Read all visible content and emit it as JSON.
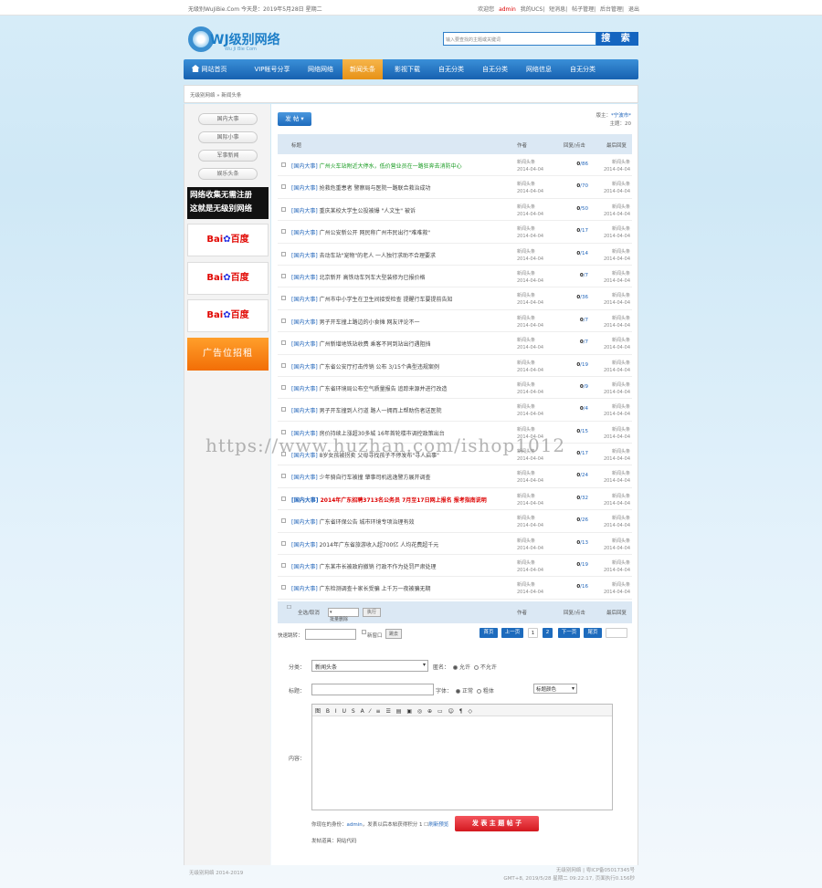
{
  "topbar": {
    "left": "无级别WuJiBie.Com 今天是：2019年5月28日 星期二",
    "welcome": "欢迎您",
    "user": "admin",
    "links": [
      "我的UCS",
      "短消息",
      "帖子管理",
      "后台管理",
      "退出"
    ]
  },
  "logo": {
    "title": "WJ级别网络",
    "subtitle": "Wu Ji Bie Com"
  },
  "search": {
    "placeholder": "输入要查找的主题或关键词",
    "button": "搜 索"
  },
  "nav": {
    "items": [
      "网站首页",
      "VIP帐号分享",
      "网络网络",
      "新闻头条",
      "影视下载",
      "自无分类",
      "自无分类",
      "网络信息",
      "自无分类"
    ]
  },
  "breadcrumb": "无级别网络 » 新闻头条",
  "sidebar": {
    "buttons": [
      "国内大事",
      "国际小事",
      "军事新闻",
      "娱乐头条"
    ],
    "promo_lines": [
      "网络收集无需注册",
      "这就是无级别网络"
    ],
    "baidu": {
      "part1": "Bai",
      "part2": "百度"
    },
    "ad": "广告位招租"
  },
  "board": {
    "post_label": "发 帖",
    "master_label": "版主：",
    "master": "*宁波市*",
    "topics_label": "主题：",
    "topics": "20"
  },
  "table": {
    "headers": {
      "title": "标题",
      "author": "作者",
      "replies": "回复/点击",
      "last": "最后回复"
    },
    "rows": [
      {
        "cat": "[国内大事]",
        "title": "广州火车站附近大停水，低价营业员在一路狂奔去消防中心",
        "style": "green",
        "author": "新闻头条",
        "date": "2014-04-04",
        "r": "0",
        "v": "86",
        "last_by": "新闻头条",
        "last_date": "2014-04-04"
      },
      {
        "cat": "[国内大事]",
        "title": "抢救危重患者 警察局与医院一路联合救治成功",
        "style": "",
        "author": "新闻头条",
        "date": "2014-04-04",
        "r": "0",
        "v": "70",
        "last_by": "新闻头条",
        "last_date": "2014-04-04"
      },
      {
        "cat": "[国内大事]",
        "title": "重庆某校大学生公投被爆 \"人文生\" 被诉",
        "style": "",
        "author": "新闻头条",
        "date": "2014-04-04",
        "r": "0",
        "v": "50",
        "last_by": "新闻头条",
        "last_date": "2014-04-04"
      },
      {
        "cat": "[国内大事]",
        "title": "广州公安新公开 网民称广州市民出行\"难难救\"",
        "style": "",
        "author": "新闻头条",
        "date": "2014-04-04",
        "r": "0",
        "v": "17",
        "last_by": "新闻头条",
        "last_date": "2014-04-04"
      },
      {
        "cat": "[国内大事]",
        "title": "去动车站\"宠物\"的老人 一人独行求助不合理要求",
        "style": "",
        "author": "新闻头条",
        "date": "2014-04-04",
        "r": "0",
        "v": "14",
        "last_by": "新闻头条",
        "last_date": "2014-04-04"
      },
      {
        "cat": "[国内大事]",
        "title": "北京新开 高铁动车列车大型装修为已报价格",
        "style": "",
        "author": "新闻头条",
        "date": "2014-04-04",
        "r": "0",
        "v": "7",
        "last_by": "新闻头条",
        "last_date": "2014-04-04"
      },
      {
        "cat": "[国内大事]",
        "title": "广州市中小学生在卫生间接受检查 提醒行车要提前告知",
        "style": "",
        "author": "新闻头条",
        "date": "2014-04-04",
        "r": "0",
        "v": "36",
        "last_by": "新闻头条",
        "last_date": "2014-04-04"
      },
      {
        "cat": "[国内大事]",
        "title": "男子开车撞上路边的小食摊 网友评论不一",
        "style": "",
        "author": "新闻头条",
        "date": "2014-04-04",
        "r": "0",
        "v": "7",
        "last_by": "新闻头条",
        "last_date": "2014-04-04"
      },
      {
        "cat": "[国内大事]",
        "title": "广州新增地铁站收费 乘客不同到站出行遇阻挡",
        "style": "",
        "author": "新闻头条",
        "date": "2014-04-04",
        "r": "0",
        "v": "7",
        "last_by": "新闻头条",
        "last_date": "2014-04-04"
      },
      {
        "cat": "[国内大事]",
        "title": "广东省公安厅打击传销 公布 3/15个典型违规案例",
        "style": "",
        "author": "新闻头条",
        "date": "2014-04-04",
        "r": "0",
        "v": "19",
        "last_by": "新闻头条",
        "last_date": "2014-04-04"
      },
      {
        "cat": "[国内大事]",
        "title": "广东省环境局公布空气质量报告 追踪来源并进行改造",
        "style": "",
        "author": "新闻头条",
        "date": "2014-04-04",
        "r": "0",
        "v": "9",
        "last_by": "新闻头条",
        "last_date": "2014-04-04"
      },
      {
        "cat": "[国内大事]",
        "title": "男子开车撞到人行道 路人一拥而上帮助伤者送医院",
        "style": "",
        "author": "新闻头条",
        "date": "2014-04-04",
        "r": "0",
        "v": "4",
        "last_by": "新闻头条",
        "last_date": "2014-04-04"
      },
      {
        "cat": "[国内大事]",
        "title": "房价持续上涨超30多城 16年首轮楼市调控政策出台",
        "style": "",
        "author": "新闻头条",
        "date": "2014-04-04",
        "r": "0",
        "v": "15",
        "last_by": "新闻头条",
        "last_date": "2014-04-04"
      },
      {
        "cat": "[国内大事]",
        "title": "8岁女孩被拐卖 父母寻找孩子不停发布\"寻人启事\"",
        "style": "",
        "author": "新闻头条",
        "date": "2014-04-04",
        "r": "0",
        "v": "17",
        "last_by": "新闻头条",
        "last_date": "2014-04-04"
      },
      {
        "cat": "[国内大事]",
        "title": "少年骑自行车被撞 肇事司机逃逸警方展开调查",
        "style": "",
        "author": "新闻头条",
        "date": "2014-04-04",
        "r": "0",
        "v": "24",
        "last_by": "新闻头条",
        "last_date": "2014-04-04"
      },
      {
        "cat": "[国内大事]",
        "title": "2014年广东招聘3713名公务员 7月至17日网上报名 报考指南说明",
        "style": "red",
        "author": "新闻头条",
        "date": "2014-04-04",
        "r": "0",
        "v": "32",
        "last_by": "新闻头条",
        "last_date": "2014-04-04"
      },
      {
        "cat": "[国内大事]",
        "title": "广东省环保公告 城市环境专项治理有效",
        "style": "",
        "author": "新闻头条",
        "date": "2014-04-04",
        "r": "0",
        "v": "26",
        "last_by": "新闻头条",
        "last_date": "2014-04-04"
      },
      {
        "cat": "[国内大事]",
        "title": "2014年广东省旅游收入超700亿 人均花费超千元",
        "style": "",
        "author": "新闻头条",
        "date": "2014-04-04",
        "r": "0",
        "v": "13",
        "last_by": "新闻头条",
        "last_date": "2014-04-04"
      },
      {
        "cat": "[国内大事]",
        "title": "广东某市长被政府撤销 行政不作为处罚严肃处理",
        "style": "",
        "author": "新闻头条",
        "date": "2014-04-04",
        "r": "0",
        "v": "19",
        "last_by": "新闻头条",
        "last_date": "2014-04-04"
      },
      {
        "cat": "[国内大事]",
        "title": "广东检测调查十家长受骗 上千万一夜被骗无期",
        "style": "",
        "author": "新闻头条",
        "date": "2014-04-04",
        "r": "0",
        "v": "16",
        "last_by": "新闻头条",
        "last_date": "2014-04-04"
      }
    ],
    "footer": {
      "select_all": "全选/取消",
      "batch": "批量删除",
      "go": "执行",
      "author": "作者",
      "replies": "回复/点击",
      "last": "最后回复"
    }
  },
  "jump": {
    "label": "快速跳转：",
    "newwin": "新窗口",
    "go": "跳去"
  },
  "pager": {
    "first": "首页",
    "prev": "上一页",
    "p1": "1",
    "p2": "2",
    "next": "下一页",
    "last": "尾页"
  },
  "form": {
    "category_label": "分类：",
    "category_value": "新闻头条",
    "anon_label": "匿名：",
    "anon_opts": [
      "允许",
      "不允许"
    ],
    "title_label": "标题：",
    "font_label": "字体：",
    "font_opts": [
      "正常",
      "粗体"
    ],
    "font_select": "标题颜色",
    "toolbar": "图 B I U S A ⁄ ≡ ☰ ▤ ▣ ◎ ⊕ ▭ ☺ ¶ ◇",
    "content_label": "内容：",
    "info_prefix": "你现在的身份：",
    "info_user": "admin",
    "info_suffix": "，发表以后本帖获得积分 1",
    "preview_label": "刷新预览",
    "submit": "发 表 主 题 帖 子",
    "tools": "发帖道具：网站代码"
  },
  "footer": {
    "left": "无级别网络  2014-2019",
    "right1": "无级别网络  |  粤ICP备05017345号",
    "right2": "GMT+8, 2019/5/28 星期二 09:22:17, 页面执行0.156秒"
  },
  "watermark": "https://www.huzhan.com/ishop1012"
}
